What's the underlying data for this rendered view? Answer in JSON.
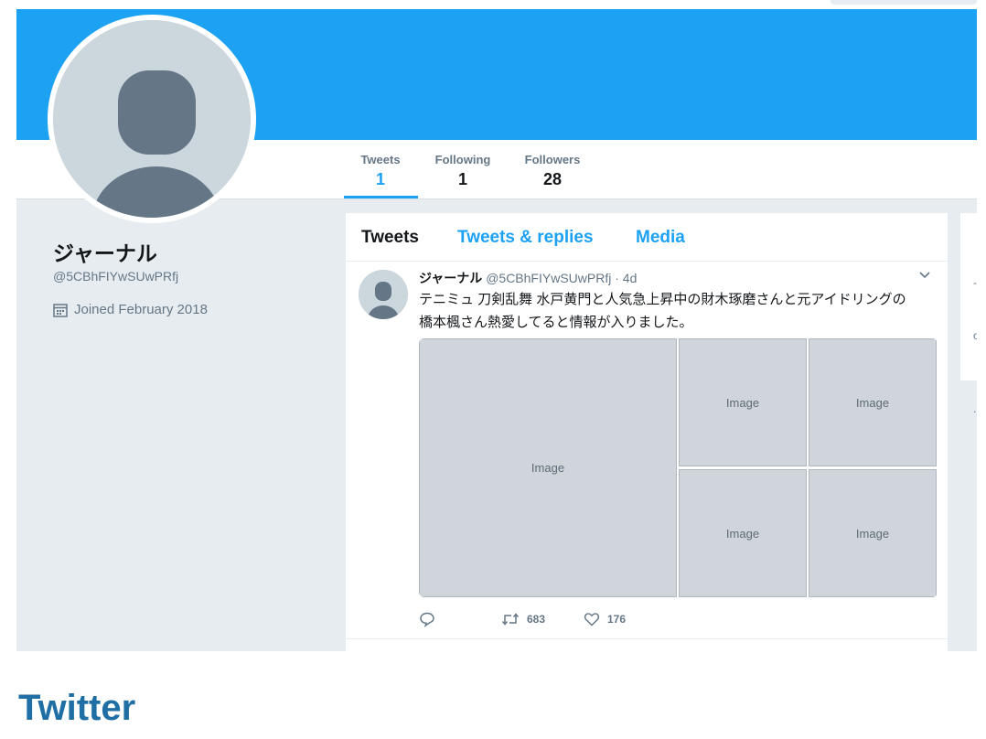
{
  "banner": {
    "color": "#1da1f2"
  },
  "profile_nav": {
    "stats": [
      {
        "label": "Tweets",
        "value": "1",
        "active": true
      },
      {
        "label": "Following",
        "value": "1",
        "active": false
      },
      {
        "label": "Followers",
        "value": "28",
        "active": false
      }
    ]
  },
  "profile": {
    "name": "ジャーナル",
    "handle": "@5CBhFIYwSUwPRfj",
    "joined": "Joined February 2018",
    "avatar_icon": "default-user-avatar-icon",
    "calendar_icon": "calendar-icon"
  },
  "timeline": {
    "tabs": [
      {
        "label": "Tweets",
        "active": true
      },
      {
        "label": "Tweets & replies",
        "active": false
      },
      {
        "label": "Media",
        "active": false
      }
    ],
    "tweet": {
      "name": "ジャーナル",
      "handle": "@5CBhFIYwSUwPRfj",
      "time": "· 4d",
      "text_line_1": "テニミュ 刀剣乱舞 水戸黄門と人気急上昇中の財木琢磨さんと元アイドリングの",
      "text_line_2": "橋本楓さん熱愛してると情報が入りました。",
      "caret_icon": "chevron-down-icon",
      "media": [
        {
          "name": "photo-1",
          "placeholder": "Image"
        },
        {
          "name": "photo-2",
          "placeholder": "Image"
        },
        {
          "name": "photo-3",
          "placeholder": "Image"
        },
        {
          "name": "photo-4",
          "placeholder": "Image"
        },
        {
          "name": "photo-5",
          "placeholder": "Image"
        }
      ],
      "actions": {
        "reply_icon": "reply-icon",
        "retweet_icon": "retweet-icon",
        "retweet_count": "683",
        "like_icon": "heart-icon",
        "like_count": "176"
      }
    }
  },
  "footer": {
    "title": "Twitter"
  },
  "colors": {
    "accent": "#1da1f2",
    "page_bg": "#e6ecf0",
    "footer_title": "#1f6fa5"
  }
}
